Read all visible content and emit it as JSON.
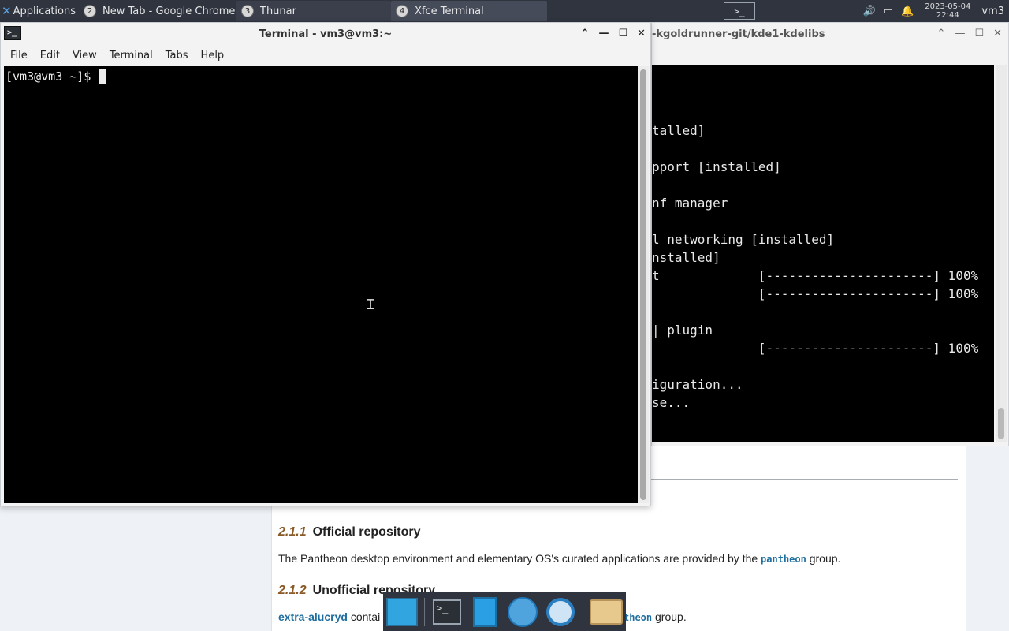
{
  "panel": {
    "applications_label": "Applications",
    "tasks": [
      {
        "badge": "2",
        "label": "New Tab - Google Chrome"
      },
      {
        "badge": "3",
        "label": "Thunar"
      },
      {
        "badge": "4",
        "label": "Xfce Terminal"
      }
    ],
    "workspace_icon": ">_",
    "date": "2023-05-04",
    "time": "22:44",
    "user": "vm3"
  },
  "page": {
    "section_1_num": "2.1.1",
    "section_1_title": "Official repository",
    "para_1_before": "The Pantheon desktop environment and elementary OS's curated applications are provided by the",
    "para_1_code": "pantheon",
    "para_1_after": "group.",
    "section_2_num": "2.1.2",
    "section_2_title": "Unofficial repository",
    "para_2_link": "extra-alucryd",
    "para_2_text": "contai",
    "para_2_code_tail": "theon",
    "para_2_after": "group."
  },
  "back_window": {
    "title": "-kgoldrunner-git/kde1-kdelibs",
    "lines": [
      "talled]",
      "pport [installed]",
      "nf manager",
      "l networking [installed]",
      "nstalled]",
      "t             [----------------------] 100%",
      "              [----------------------] 100%",
      "| plugin",
      "              [----------------------] 100%",
      "iguration...",
      "se..."
    ]
  },
  "front_window": {
    "title": "Terminal - vm3@vm3:~",
    "menu": [
      "File",
      "Edit",
      "View",
      "Terminal",
      "Tabs",
      "Help"
    ],
    "prompt": "[vm3@vm3 ~]$"
  }
}
